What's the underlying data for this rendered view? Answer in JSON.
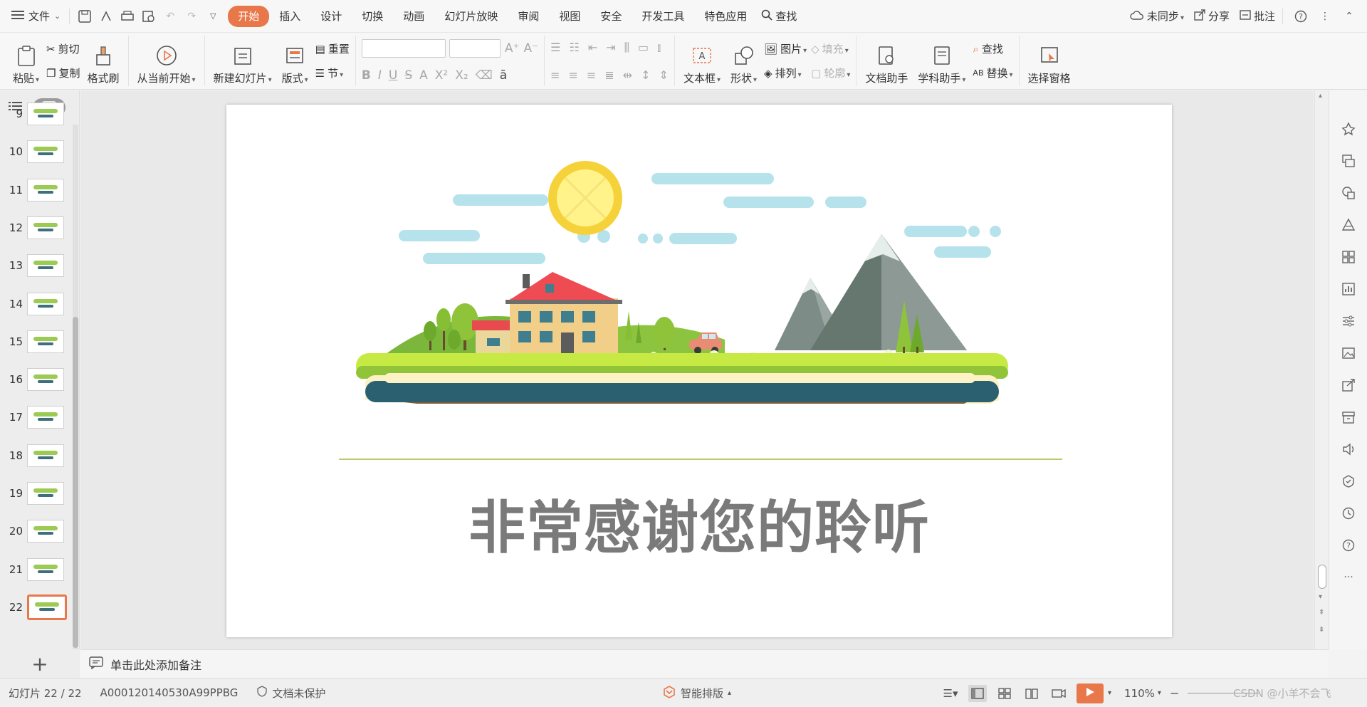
{
  "menubar": {
    "file_label": "文件",
    "tabs": [
      "开始",
      "插入",
      "设计",
      "切换",
      "动画",
      "幻灯片放映",
      "审阅",
      "视图",
      "安全",
      "开发工具",
      "特色应用"
    ],
    "search_label": "查找",
    "sync_label": "未同步",
    "share_label": "分享",
    "comment_label": "批注"
  },
  "ribbon": {
    "paste": "粘贴",
    "cut": "剪切",
    "copy": "复制",
    "format_painter": "格式刷",
    "from_current": "从当前开始",
    "new_slide": "新建幻灯片",
    "layout": "版式",
    "reset": "重置",
    "section": "节",
    "textbox": "文本框",
    "shape": "形状",
    "picture": "图片",
    "fill": "填充",
    "arrange": "排列",
    "outline": "轮廓",
    "doc_assistant": "文档助手",
    "subject_assistant": "学科助手",
    "find": "查找",
    "replace": "替换",
    "select_pane": "选择窗格"
  },
  "thumbnails": {
    "numbers": [
      "9",
      "10",
      "11",
      "12",
      "13",
      "14",
      "15",
      "16",
      "17",
      "18",
      "19",
      "20",
      "21",
      "22"
    ],
    "selected": "22"
  },
  "slide": {
    "title": "非常感谢您的聆听"
  },
  "notes": {
    "placeholder": "单击此处添加备注"
  },
  "status": {
    "slide_count": "幻灯片 22 / 22",
    "template_id": "A000120140530A99PPBG",
    "protection": "文档未保护",
    "smart_layout": "智能排版",
    "zoom": "110%",
    "watermark": "CSDN @小羊不会飞"
  },
  "colors": {
    "accent": "#e8774a",
    "title_gray": "#7a7a7a"
  }
}
